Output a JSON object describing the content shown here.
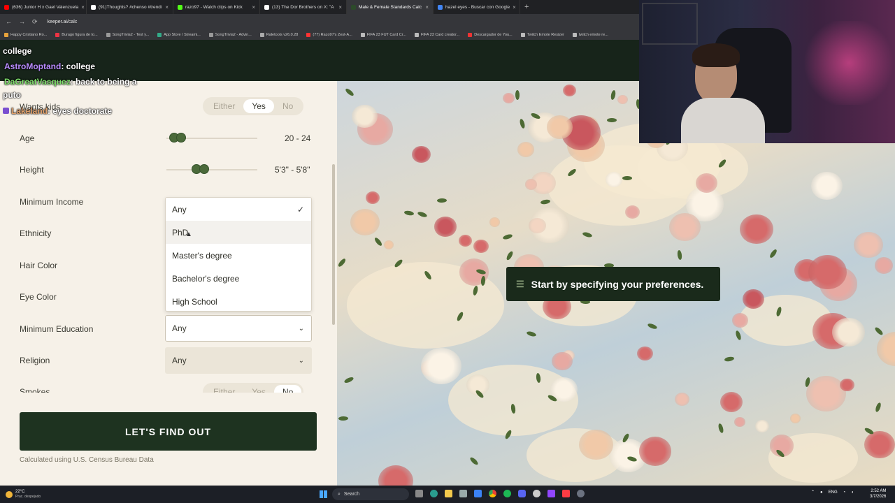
{
  "browser": {
    "tabs": [
      {
        "label": "(636) Junior H x Gael Valenzuela",
        "color": "#ff0000",
        "active": false
      },
      {
        "label": "(91)Thoughts? #chenso #trendi",
        "color": "#ffffff",
        "active": false
      },
      {
        "label": "razo97 - Watch clips on Kick",
        "color": "#53fc18",
        "active": false
      },
      {
        "label": "(13) The Dor Brothers on X: \"A",
        "color": "#ffffff",
        "active": false
      },
      {
        "label": "Male & Female Standards Calc",
        "color": "#2c4a2a",
        "active": true
      },
      {
        "label": "hazel eyes - Buscar con Google",
        "color": "#4285f4",
        "active": false
      }
    ],
    "new_tab_glyph": "+",
    "url": "keeper.ai/calc",
    "bookmarks": [
      {
        "label": "Happy Cristiano Ro...",
        "color": "#e8a33c"
      },
      {
        "label": "Burago figura de to...",
        "color": "#e34"
      },
      {
        "label": "SongTrivia2 - Test y...",
        "color": "#999"
      },
      {
        "label": "App Store / Streami...",
        "color": "#3a8"
      },
      {
        "label": "SongTrivia2 - Advin...",
        "color": "#999"
      },
      {
        "label": "Raletools v26.0.28",
        "color": "#aaa"
      },
      {
        "label": "(77) Razo97's Zest-A...",
        "color": "#f33"
      },
      {
        "label": "FIFA 23 FUT Card Cr...",
        "color": "#bbb"
      },
      {
        "label": "FIFA 23 Card creator...",
        "color": "#bbb"
      },
      {
        "label": "Descargador de You...",
        "color": "#e33"
      },
      {
        "label": "Twitch Emote Resizer",
        "color": "#bbb"
      },
      {
        "label": "twitch emote re...",
        "color": "#bbb"
      }
    ]
  },
  "chat": {
    "line1": "college",
    "line2_user": "AstroMoptand",
    "line2_msg": ": college",
    "line3_user": "DaGreatVasquez",
    "line3_msg": ": back to being a",
    "line3b": "puto",
    "line4_user": "Lakeland",
    "line4_msg": ": eyes doctorate"
  },
  "form": {
    "wants_kids": {
      "label": "Wants kids",
      "options": [
        "Either",
        "Yes",
        "No"
      ],
      "selected": "Yes"
    },
    "age": {
      "label": "Age",
      "value": "20 - 24"
    },
    "height": {
      "label": "Height",
      "value": "5'3\" - 5'8\""
    },
    "minimum_income": {
      "label": "Minimum Income"
    },
    "ethnicity": {
      "label": "Ethnicity"
    },
    "hair_color": {
      "label": "Hair Color"
    },
    "eye_color": {
      "label": "Eye Color"
    },
    "minimum_education": {
      "label": "Minimum Education",
      "value": "Any"
    },
    "religion": {
      "label": "Religion",
      "value": "Any"
    },
    "smokes": {
      "label": "Smokes",
      "options": [
        "Either",
        "Yes",
        "No"
      ],
      "selected": "No"
    },
    "dropdown": {
      "options": [
        "Any",
        "PhD",
        "Master's degree",
        "Bachelor's degree",
        "High School"
      ],
      "selected": "Any",
      "hovered": "PhD"
    },
    "submit_label": "LET'S FIND OUT",
    "footnote": "Calculated using U.S. Census Bureau Data"
  },
  "toast": {
    "text": "Start by specifying your preferences.",
    "icon": "sliders-icon"
  },
  "taskbar": {
    "weather_temp": "22°C",
    "weather_desc": "Prac. despejado",
    "search_label": "Search",
    "language": "ENG",
    "time": "2:52 AM",
    "date": "3/7/2026"
  },
  "colors": {
    "accent_dark_green": "#1e3320",
    "panel_bg": "#f6f1e8",
    "slider_knob": "#4b6a3a"
  }
}
